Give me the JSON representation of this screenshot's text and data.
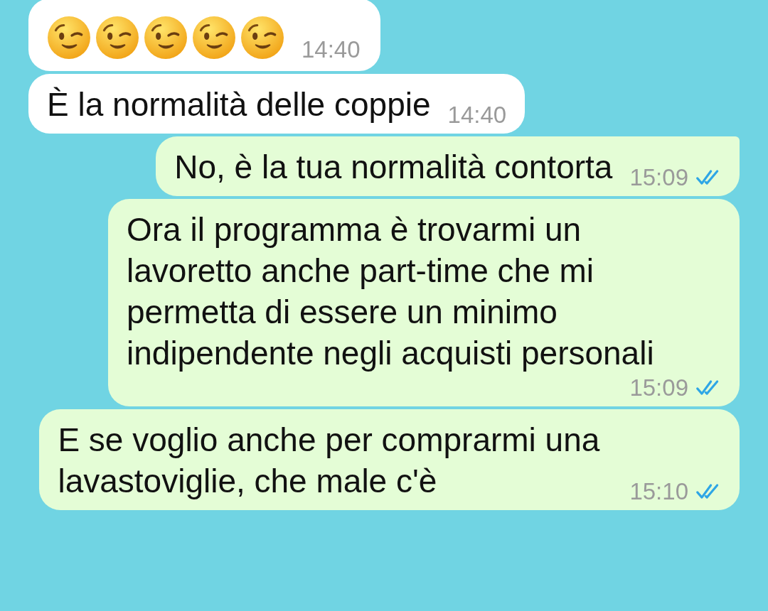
{
  "messages": [
    {
      "outgoing": false,
      "kind": "emoji",
      "emojis": [
        {
          "kind": "wink"
        },
        {
          "kind": "wink"
        },
        {
          "kind": "wink"
        },
        {
          "kind": "wink"
        },
        {
          "kind": "wink"
        }
      ],
      "time": "14:40"
    },
    {
      "outgoing": false,
      "kind": "text",
      "text": "È la normalità delle coppie",
      "time": "14:40"
    },
    {
      "outgoing": true,
      "kind": "text",
      "text": "No, è la tua normalità contorta",
      "time": "15:09",
      "read": true,
      "tail": true
    },
    {
      "outgoing": true,
      "kind": "text",
      "text": "Ora il programma è trovarmi un lavoretto anche part-time che mi permetta di essere un minimo indipendente negli acquisti personali",
      "time": "15:09",
      "read": true,
      "tail": false
    },
    {
      "outgoing": true,
      "kind": "text",
      "text": "E se voglio anche per comprarmi una lavastoviglie, che male c'è",
      "time": "15:10",
      "read": true,
      "tail": false
    }
  ]
}
